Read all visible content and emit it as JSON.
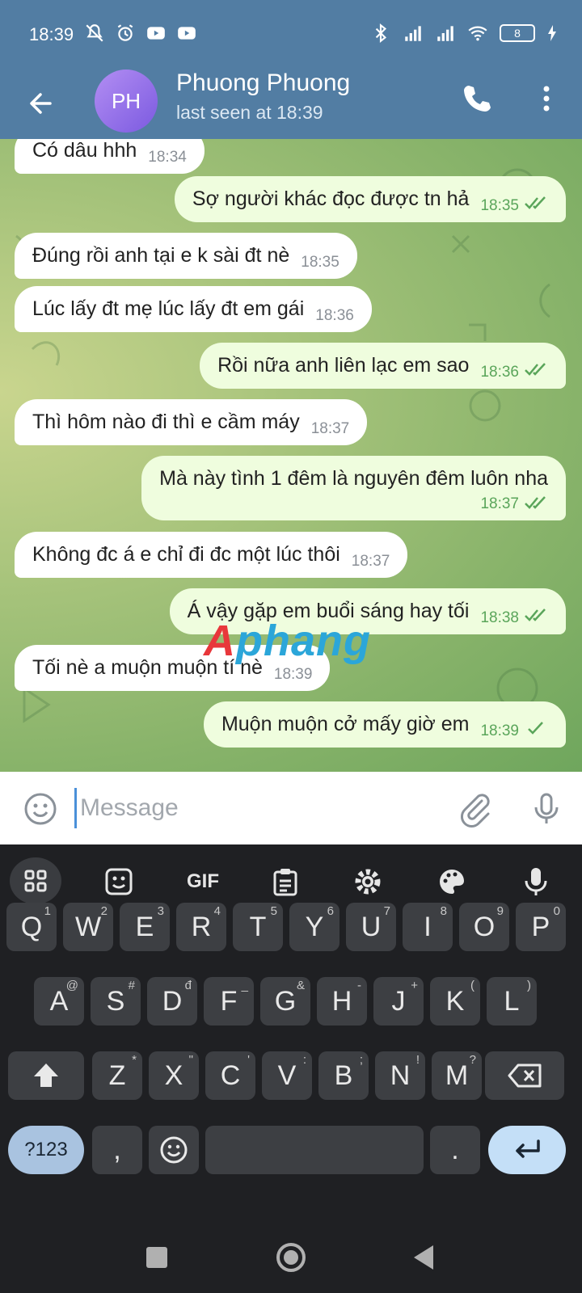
{
  "status_bar": {
    "time": "18:39",
    "battery": "8"
  },
  "header": {
    "avatar_initials": "PH",
    "contact_name": "Phuong Phuong",
    "last_seen": "last seen at 18:39"
  },
  "messages": [
    {
      "dir": "in",
      "text": "Có dâu hhh",
      "time": "18:34"
    },
    {
      "dir": "out",
      "text": "Sợ người khác đọc được tn hả",
      "time": "18:35",
      "status": "read"
    },
    {
      "dir": "in",
      "text": "Đúng rồi anh tại e k sài đt nè",
      "time": "18:35"
    },
    {
      "dir": "in",
      "text": "Lúc lấy đt mẹ lúc lấy đt em gái",
      "time": "18:36"
    },
    {
      "dir": "out",
      "text": "Rồi nữa anh liên lạc em sao",
      "time": "18:36",
      "status": "read"
    },
    {
      "dir": "in",
      "text": "Thì hôm nào đi thì e cầm máy",
      "time": "18:37"
    },
    {
      "dir": "out",
      "text": "Mà này tình 1 đêm là nguyên đêm luôn nha",
      "time": "18:37",
      "status": "read"
    },
    {
      "dir": "in",
      "text": "Không đc á e chỉ đi đc một lúc thôi",
      "time": "18:37"
    },
    {
      "dir": "out",
      "text": "Á vậy gặp em buổi sáng hay tối",
      "time": "18:38",
      "status": "read"
    },
    {
      "dir": "in",
      "text": "Tối nè a muộn muộn tí nè",
      "time": "18:39"
    },
    {
      "dir": "out",
      "text": "Muộn muộn cở mấy giờ em",
      "time": "18:39",
      "status": "sent"
    }
  ],
  "watermark": {
    "first": "A",
    "rest": "phang"
  },
  "input": {
    "placeholder": "Message"
  },
  "keyboard": {
    "toolbar": [
      "apps-grid",
      "sticker",
      "GIF",
      "clipboard",
      "settings",
      "palette",
      "voice"
    ],
    "gif_label": "GIF",
    "row1": [
      {
        "k": "Q",
        "h": "1"
      },
      {
        "k": "W",
        "h": "2"
      },
      {
        "k": "E",
        "h": "3"
      },
      {
        "k": "R",
        "h": "4"
      },
      {
        "k": "T",
        "h": "5"
      },
      {
        "k": "Y",
        "h": "6"
      },
      {
        "k": "U",
        "h": "7"
      },
      {
        "k": "I",
        "h": "8"
      },
      {
        "k": "O",
        "h": "9"
      },
      {
        "k": "P",
        "h": "0"
      }
    ],
    "row2": [
      {
        "k": "A",
        "h": "@"
      },
      {
        "k": "S",
        "h": "#"
      },
      {
        "k": "D",
        "h": "đ"
      },
      {
        "k": "F",
        "h": "_"
      },
      {
        "k": "G",
        "h": "&"
      },
      {
        "k": "H",
        "h": "-"
      },
      {
        "k": "J",
        "h": "+"
      },
      {
        "k": "K",
        "h": "("
      },
      {
        "k": "L",
        "h": ")"
      }
    ],
    "row3": [
      {
        "k": "Z",
        "h": "*"
      },
      {
        "k": "X",
        "h": "\""
      },
      {
        "k": "C",
        "h": "'"
      },
      {
        "k": "V",
        "h": ":"
      },
      {
        "k": "B",
        "h": ";"
      },
      {
        "k": "N",
        "h": "!"
      },
      {
        "k": "M",
        "h": "?"
      }
    ],
    "sym_label": "?123",
    "comma_label": ",",
    "period_label": "."
  }
}
